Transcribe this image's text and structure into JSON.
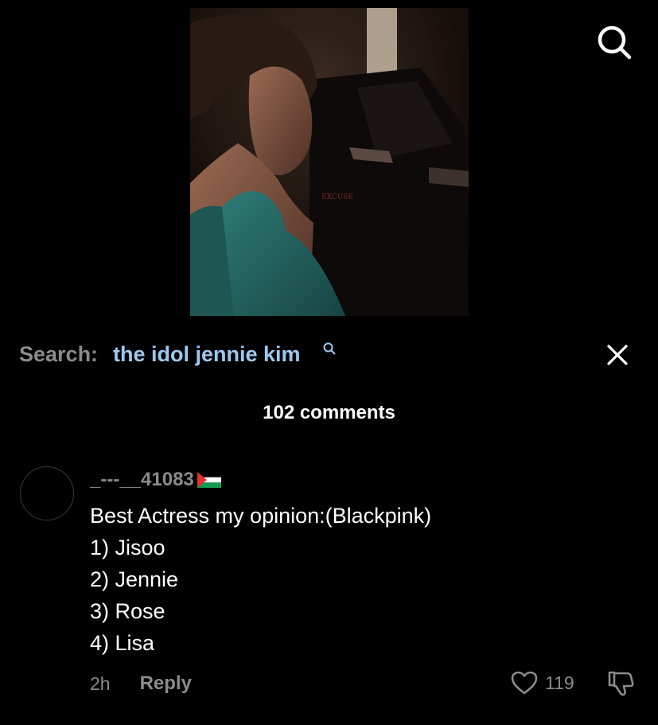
{
  "search": {
    "label": "Search:",
    "query": "the idol jennie kim"
  },
  "comments": {
    "count_label": "102 comments",
    "items": [
      {
        "username": "_---__41083",
        "flag": "palestine-flag",
        "lines": [
          "Best Actress my opinion:(Blackpink)",
          "1) Jisoo",
          "2) Jennie",
          "3) Rose",
          "4) Lisa"
        ],
        "time": "2h",
        "reply_label": "Reply",
        "likes": "119"
      }
    ]
  },
  "icons": {
    "top_search": "search-icon",
    "close": "close-icon",
    "like": "heart-icon",
    "dislike": "thumbs-down-icon"
  },
  "colors": {
    "background": "#000000",
    "query_blue": "#9ec8ef",
    "muted_gray": "#8b8b8b"
  }
}
